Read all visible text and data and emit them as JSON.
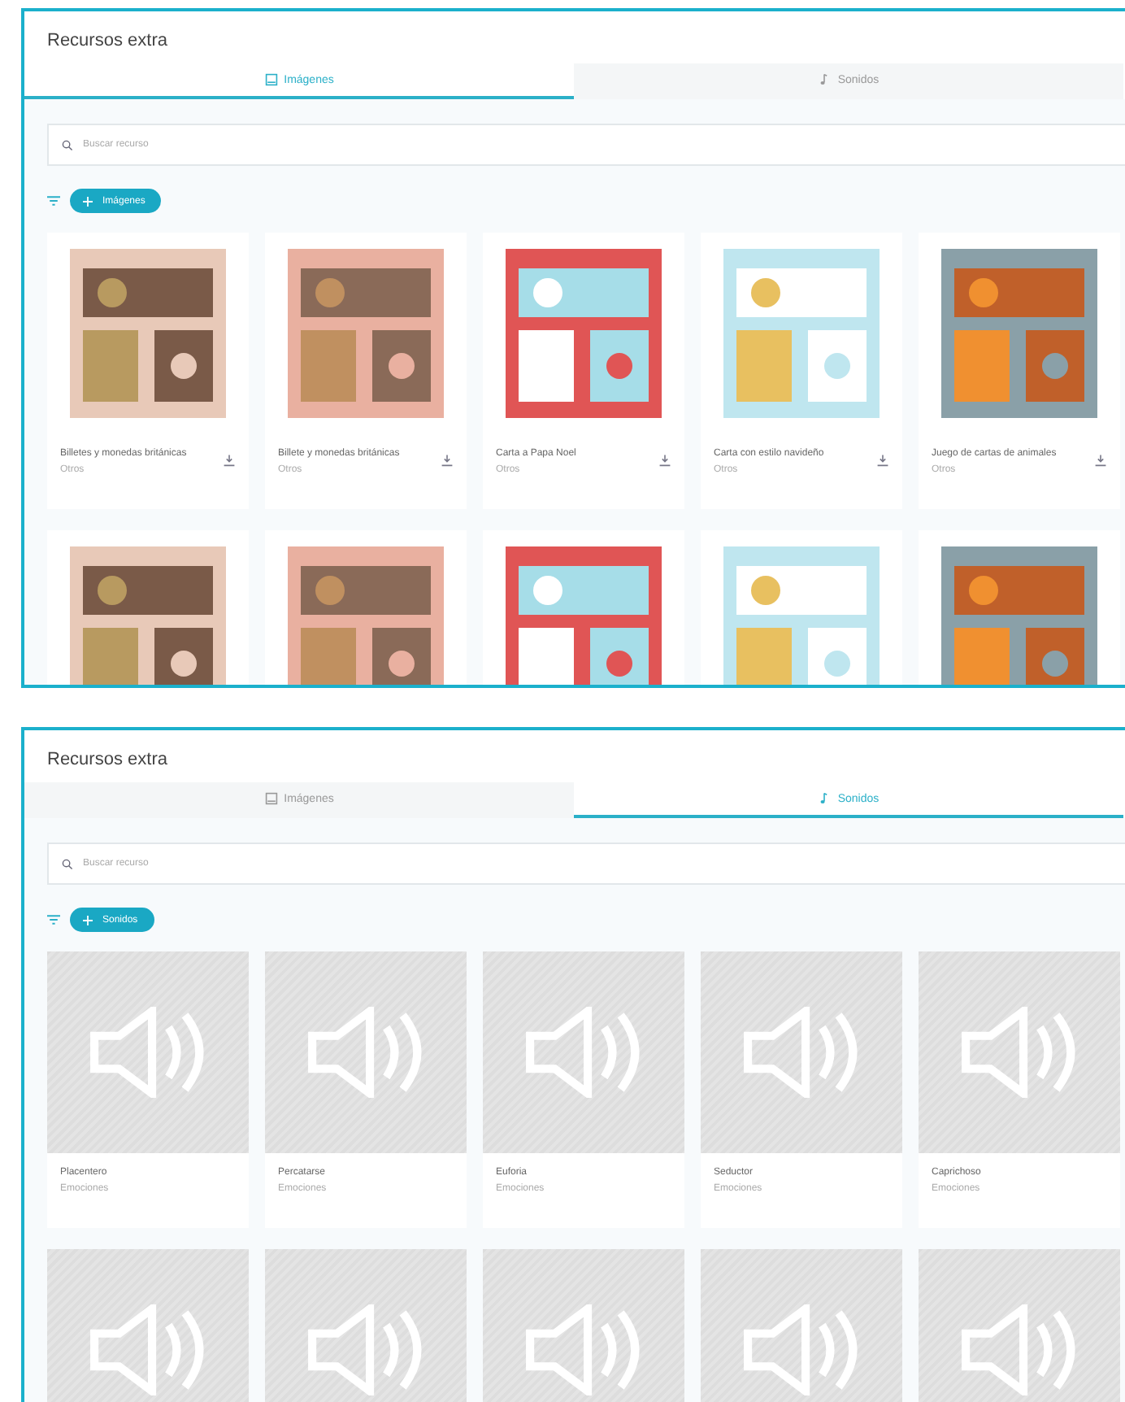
{
  "panels": [
    {
      "title": "Recursos extra",
      "tabs": [
        {
          "label": "Imágenes",
          "selected": true
        },
        {
          "label": "Sonidos",
          "selected": false
        }
      ],
      "search": {
        "placeholder": "Buscar recurso"
      },
      "filter_chip": "Imágenes",
      "cards": [
        {
          "kind": "picture",
          "title": "Billetes y monedas británicas",
          "category": "Otros"
        },
        {
          "kind": "picture",
          "title": "Billete y monedas británicas",
          "category": "Otros"
        },
        {
          "kind": "picture",
          "title": "Carta a Papa Noel",
          "category": "Otros"
        },
        {
          "kind": "picture",
          "title": "Carta con estilo navideño",
          "category": "Otros"
        },
        {
          "kind": "picture",
          "title": "Juego de cartas de animales",
          "category": "Otros"
        },
        {
          "kind": "picture"
        },
        {
          "kind": "picture"
        },
        {
          "kind": "picture"
        },
        {
          "kind": "picture"
        },
        {
          "kind": "picture"
        }
      ]
    },
    {
      "title": "Recursos extra",
      "tabs": [
        {
          "label": "Imágenes",
          "selected": false
        },
        {
          "label": "Sonidos",
          "selected": true
        }
      ],
      "search": {
        "placeholder": "Buscar recurso"
      },
      "filter_chip": "Sonidos",
      "cards": [
        {
          "kind": "sound",
          "title": "Placentero",
          "category": "Emociones"
        },
        {
          "kind": "sound",
          "title": "Percatarse",
          "category": "Emociones"
        },
        {
          "kind": "sound",
          "title": "Euforia",
          "category": "Emociones"
        },
        {
          "kind": "sound",
          "title": "Seductor",
          "category": "Emociones"
        },
        {
          "kind": "sound",
          "title": "Caprichoso",
          "category": "Emociones"
        },
        {
          "kind": "sound"
        },
        {
          "kind": "sound"
        },
        {
          "kind": "sound"
        },
        {
          "kind": "sound"
        },
        {
          "kind": "sound"
        }
      ]
    }
  ]
}
